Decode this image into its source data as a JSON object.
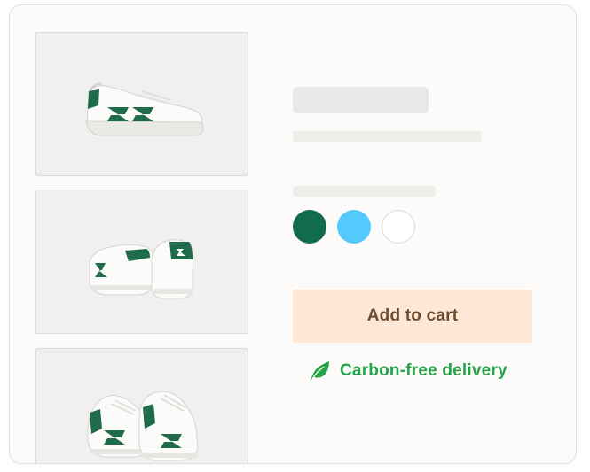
{
  "product": {
    "thumbnails": [
      {
        "icon": "sneaker-side-view-image"
      },
      {
        "icon": "sneaker-back-pair-image"
      },
      {
        "icon": "sneaker-front-pair-image"
      }
    ],
    "colors": [
      {
        "name": "green",
        "hex": "#106b4f"
      },
      {
        "name": "light-blue",
        "hex": "#55c8fd"
      },
      {
        "name": "white",
        "hex": "#ffffff"
      }
    ],
    "add_to_cart_label": "Add to cart",
    "delivery_text": "Carbon-free delivery"
  },
  "theme": {
    "card_bg": "#fcfbf9",
    "button_bg": "#fde8d8",
    "button_text": "#6e4b2f",
    "delivery_green": "#22a447",
    "shoe_green": "#1f6b4c"
  }
}
